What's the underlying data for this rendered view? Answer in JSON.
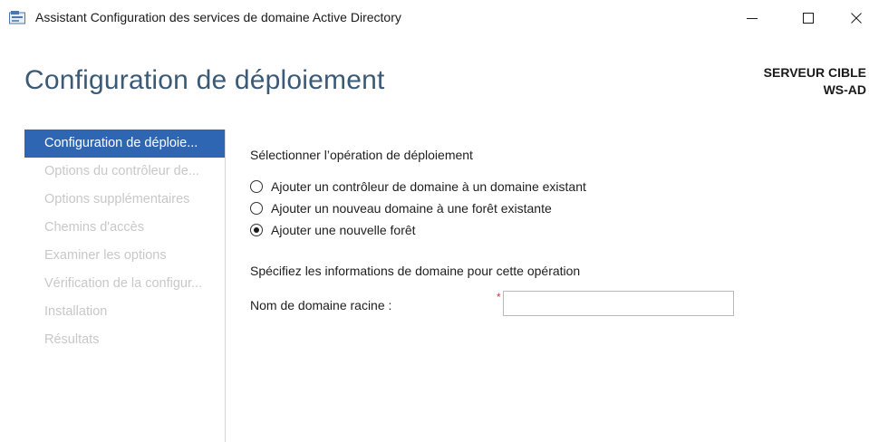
{
  "window": {
    "title": "Assistant Configuration des services de domaine Active Directory",
    "icon": "server-manager-icon"
  },
  "header": {
    "title": "Configuration de déploiement",
    "target_server_label": "SERVEUR CIBLE",
    "target_server_name": "WS-AD"
  },
  "nav": {
    "items": [
      {
        "label": "Configuration de déploie...",
        "active": true
      },
      {
        "label": "Options du contrôleur de...",
        "active": false
      },
      {
        "label": "Options supplémentaires",
        "active": false
      },
      {
        "label": "Chemins d'accès",
        "active": false
      },
      {
        "label": "Examiner les options",
        "active": false
      },
      {
        "label": "Vérification de la configur...",
        "active": false
      },
      {
        "label": "Installation",
        "active": false
      },
      {
        "label": "Résultats",
        "active": false
      }
    ]
  },
  "main": {
    "operation_label": "Sélectionner l’opération de déploiement",
    "options": [
      {
        "label": "Ajouter un contrôleur de domaine à un domaine existant",
        "checked": false
      },
      {
        "label": "Ajouter un nouveau domaine à une forêt existante",
        "checked": false
      },
      {
        "label": "Ajouter une nouvelle forêt",
        "checked": true
      }
    ],
    "domain_info_label": "Spécifiez les informations de domaine pour cette opération",
    "root_domain_label": "Nom de domaine racine :",
    "required_marker": "*",
    "root_domain_value": ""
  },
  "colors": {
    "accent": "#2f66b3",
    "title_blue": "#3a5a78",
    "required_red": "#d23a3a",
    "disabled_text": "#c8c8c8"
  }
}
